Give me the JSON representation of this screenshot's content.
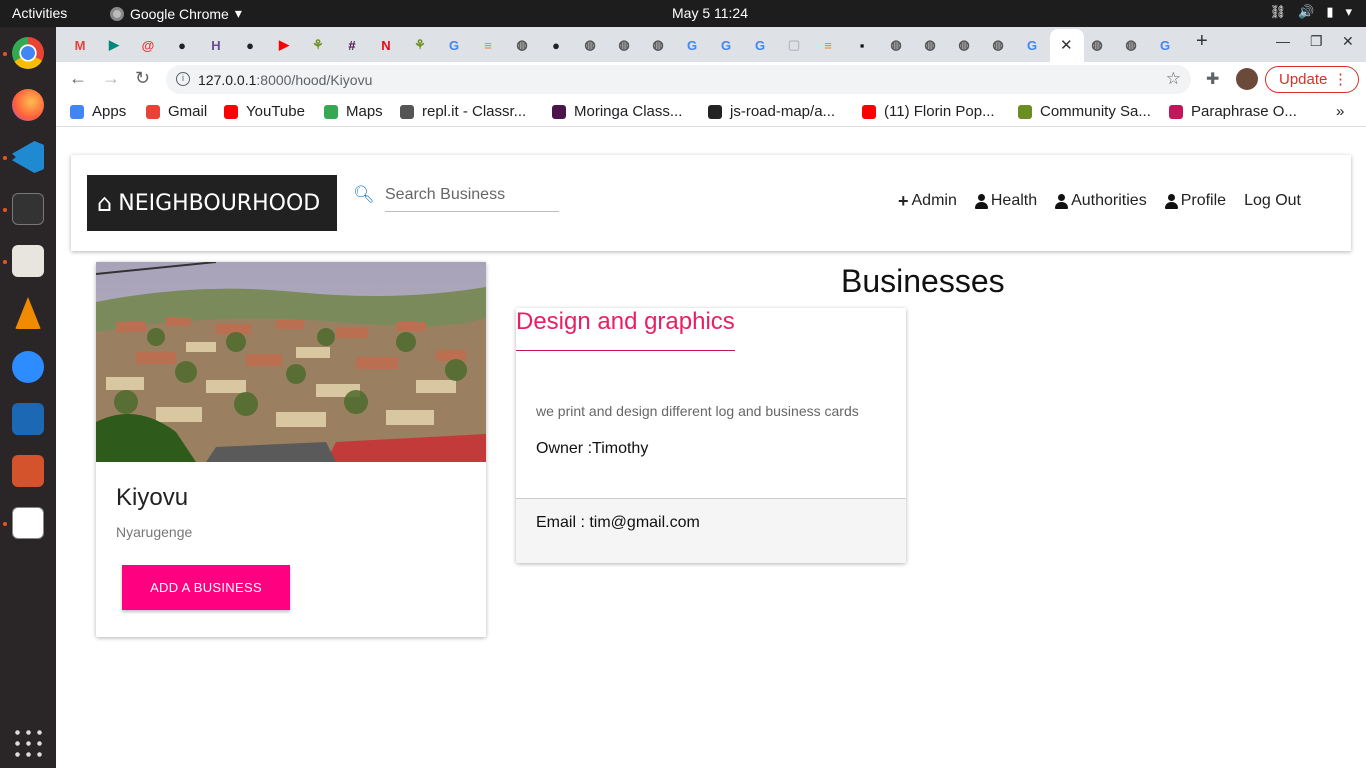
{
  "os_bar": {
    "activities": "Activities",
    "app_name": "Google Chrome",
    "clock": "May 5  11:24"
  },
  "browser": {
    "url_host": "127.0.0.1",
    "url_path": ":8000/hood/Kiyovu",
    "update_label": "Update",
    "bookmarks": [
      {
        "label": "Apps",
        "icon": "apps-grid-icon"
      },
      {
        "label": "Gmail",
        "icon": "gmail-icon"
      },
      {
        "label": "YouTube",
        "icon": "youtube-icon"
      },
      {
        "label": "Maps",
        "icon": "maps-icon"
      },
      {
        "label": "repl.it - Classr...",
        "icon": "replit-icon"
      },
      {
        "label": "Moringa Class...",
        "icon": "slack-icon"
      },
      {
        "label": "js-road-map/a...",
        "icon": "github-icon"
      },
      {
        "label": "(11) Florin Pop...",
        "icon": "youtube-icon"
      },
      {
        "label": "Community Sa...",
        "icon": "tree-icon"
      },
      {
        "label": "Paraphrase O...",
        "icon": "paraphrase-icon"
      }
    ]
  },
  "navbar": {
    "brand": "NEIGHBOURHOOD",
    "search_placeholder": "Search Business",
    "links": {
      "admin": "Admin",
      "health": "Health",
      "authorities": "Authorities",
      "profile": "Profile",
      "logout": "Log Out"
    }
  },
  "hood": {
    "name": "Kiyovu",
    "location": "Nyarugenge",
    "add_business_label": "ADD A BUSINESS"
  },
  "businesses": {
    "heading": "Businesses",
    "items": [
      {
        "title": "Design and graphics",
        "description": "we print and design different log and business cards",
        "owner": "Owner :Timothy",
        "email": "Email : tim@gmail.com"
      }
    ]
  },
  "colors": {
    "accent_pink": "#ff0080",
    "title_pink": "#e91e63",
    "brand_bg": "#212121",
    "update_red": "#d93025"
  }
}
